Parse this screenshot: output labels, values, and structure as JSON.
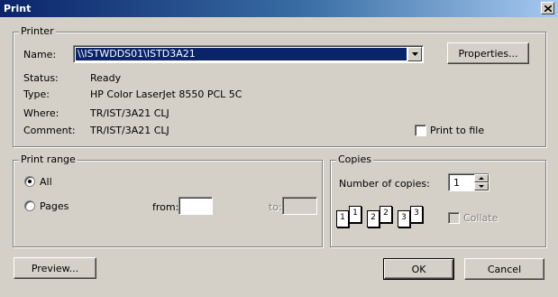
{
  "window": {
    "title": "Print"
  },
  "printer": {
    "group_label": "Printer",
    "name_label": "Name:",
    "name_value": "\\\\ISTWDDS01\\ISTD3A21",
    "properties_button": "Properties...",
    "status_label": "Status:",
    "status_value": "Ready",
    "type_label": "Type:",
    "type_value": "HP Color LaserJet 8550 PCL 5C",
    "where_label": "Where:",
    "where_value": "TR/IST/3A21 CLJ",
    "comment_label": "Comment:",
    "comment_value": "TR/IST/3A21 CLJ",
    "print_to_file_label": "Print to file",
    "print_to_file_checked": false
  },
  "print_range": {
    "group_label": "Print range",
    "all_label": "All",
    "all_selected": true,
    "pages_label": "Pages",
    "from_label": "from:",
    "from_value": "",
    "to_label": "to:",
    "to_value": ""
  },
  "copies": {
    "group_label": "Copies",
    "number_label": "Number of copies:",
    "number_value": "1",
    "collate_label": "Collate",
    "collate_checked": false,
    "collate_pages": [
      "1",
      "1",
      "2",
      "2",
      "3",
      "3"
    ]
  },
  "buttons": {
    "preview": "Preview...",
    "ok": "OK",
    "cancel": "Cancel"
  },
  "colors": {
    "dialog_bg": "#d4d0c8",
    "title_start": "#0a246a",
    "title_end": "#a6caf0",
    "selection": "#0a246a"
  }
}
